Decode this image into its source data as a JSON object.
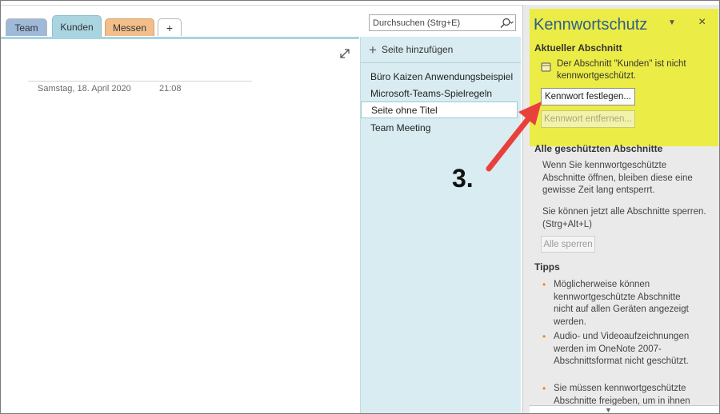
{
  "tabs": [
    {
      "label": "Team"
    },
    {
      "label": "Kunden"
    },
    {
      "label": "Messen"
    },
    {
      "label": "+"
    }
  ],
  "page": {
    "date": "Samstag, 18. April 2020",
    "time": "21:08"
  },
  "search": {
    "placeholder": "Durchsuchen (Strg+E)"
  },
  "pagelist": {
    "add_label": "Seite hinzufügen",
    "items": [
      {
        "label": "Büro Kaizen Anwendungsbeispiel"
      },
      {
        "label": "Microsoft-Teams-Spielregeln"
      },
      {
        "label": "Seite ohne Titel"
      },
      {
        "label": "Team Meeting"
      }
    ]
  },
  "panel": {
    "title": "Kennwortschutz",
    "close_glyph": "×",
    "current_heading": "Aktueller Abschnitt",
    "status_text": "Der Abschnitt \"Kunden\" ist nicht kennwortgeschützt.",
    "set_password_label": "Kennwort festlegen...",
    "remove_password_label": "Kennwort entfernen...",
    "all_heading": "Alle geschützten Abschnitte",
    "all_para1": "Wenn Sie kennwortgeschützte Abschnitte öffnen, bleiben diese eine gewisse Zeit lang entsperrt.",
    "all_para2": "Sie können jetzt alle Abschnitte sperren. (Strg+Alt+L)",
    "lock_all_label": "Alle sperren",
    "tips_heading": "Tipps",
    "tips": [
      {
        "text": "Möglicherweise können kennwortgeschützte Abschnitte nicht auf allen Geräten angezeigt werden."
      },
      {
        "text": "Audio- und Videoaufzeichnungen werden im OneNote 2007-Abschnittsformat nicht geschützt."
      },
      {
        "text": "Sie müssen kennwortgeschützte Abschnitte freigeben, um in ihnen"
      }
    ]
  },
  "annotation": {
    "step": "3."
  },
  "colors": {
    "highlight": "#ecec46",
    "arrow": "#e8413c",
    "title": "#2c5f8a",
    "tab_kunden": "#a9d5e0",
    "tab_messen": "#f2bf8a",
    "tab_team": "#9fb9d9"
  }
}
